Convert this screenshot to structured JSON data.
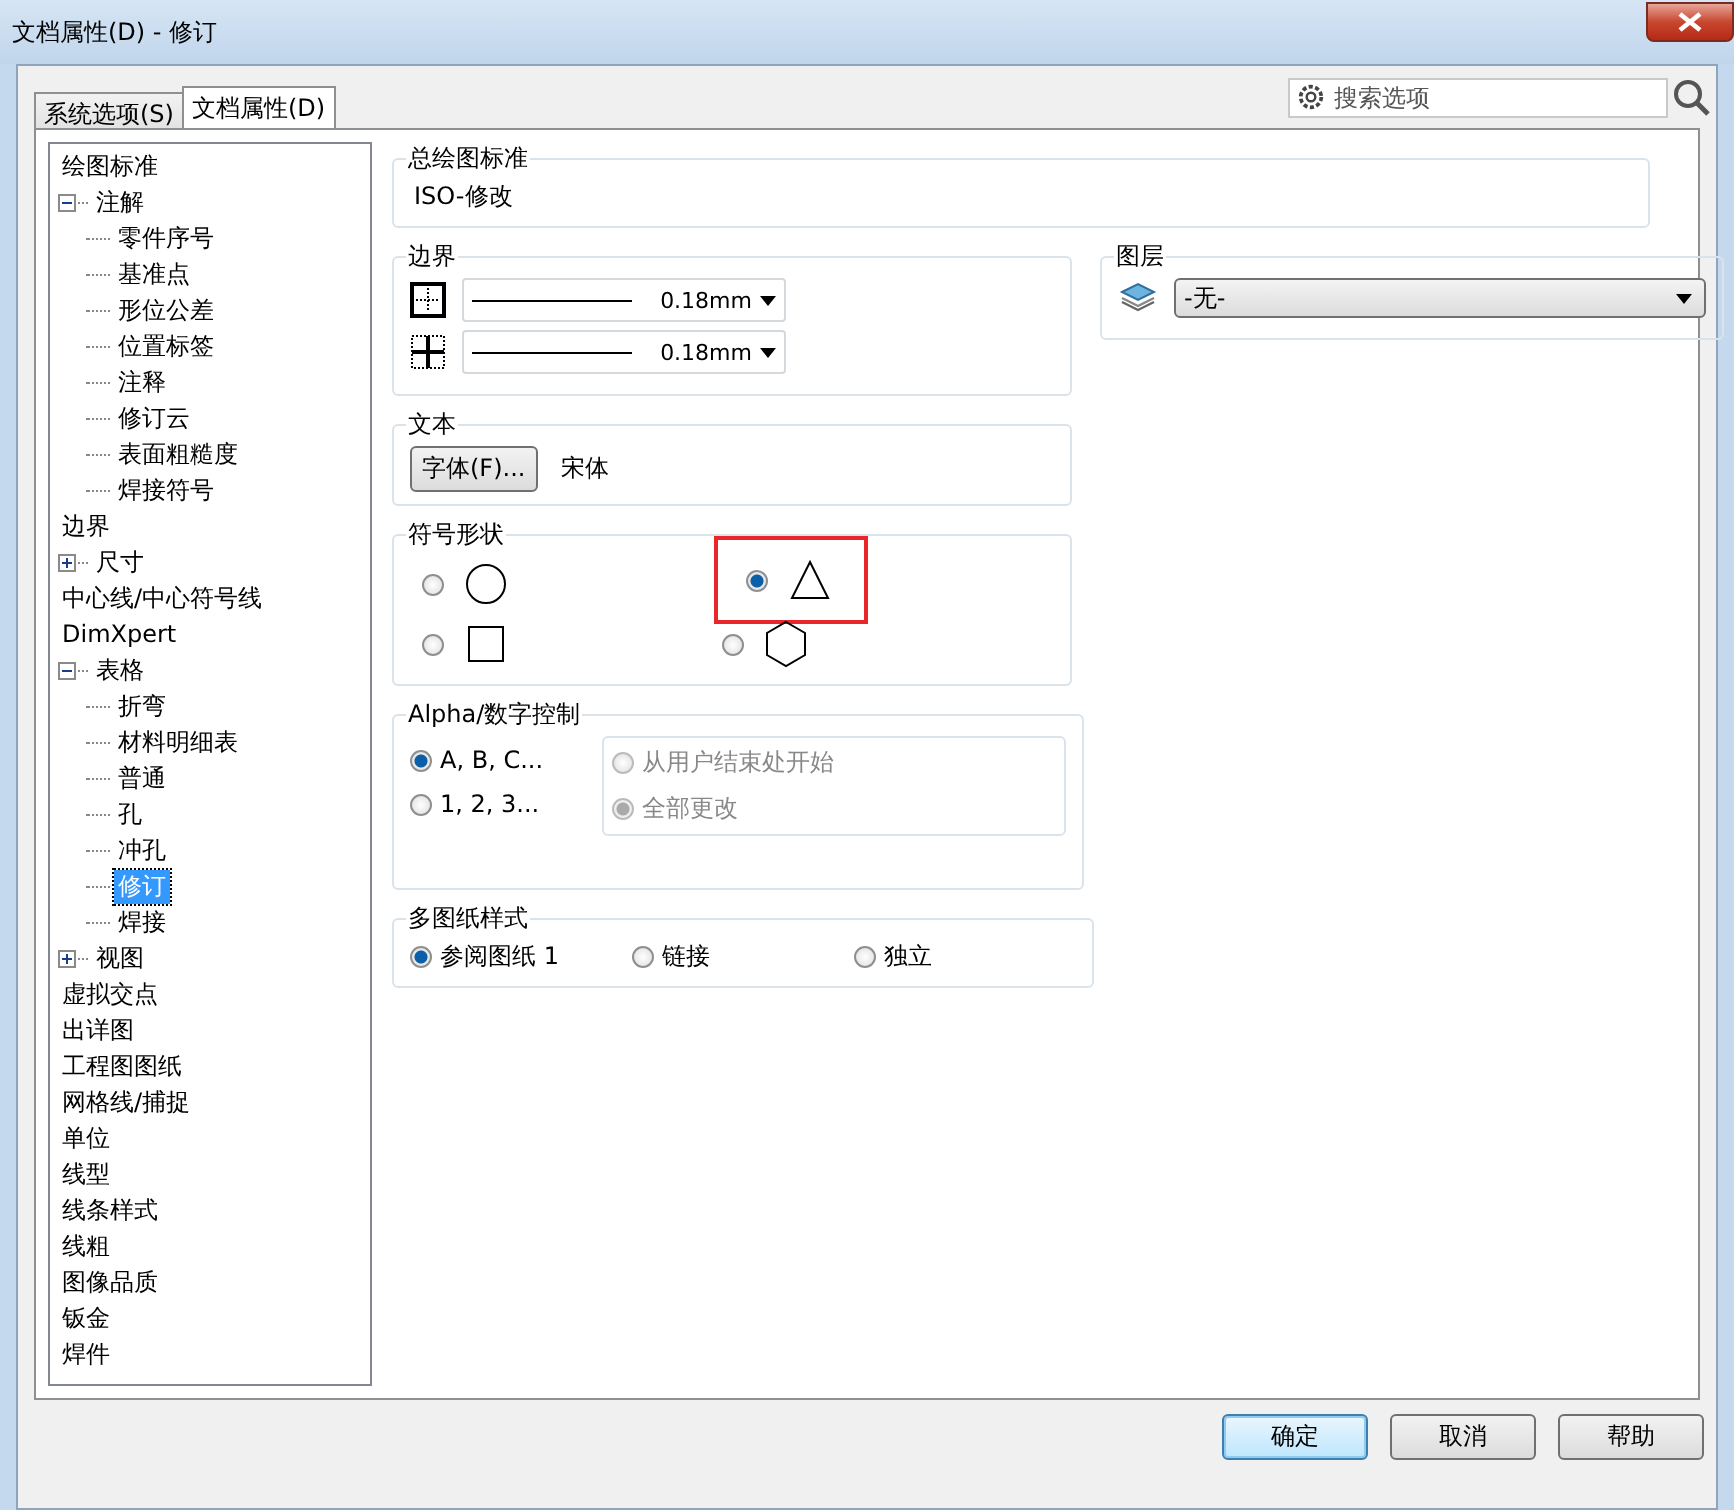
{
  "window": {
    "title": "文档属性(D) - 修订"
  },
  "tabs": [
    {
      "label": "系统选项(S)",
      "selected": false
    },
    {
      "label": "文档属性(D)",
      "selected": true
    }
  ],
  "search": {
    "placeholder": "搜索选项"
  },
  "tree": [
    {
      "label": "绘图标准",
      "selected": false
    },
    {
      "label": "注解",
      "selected": false,
      "expanded": true,
      "children": [
        {
          "label": "零件序号",
          "selected": false
        },
        {
          "label": "基准点",
          "selected": false
        },
        {
          "label": "形位公差",
          "selected": false
        },
        {
          "label": "位置标签",
          "selected": false
        },
        {
          "label": "注释",
          "selected": false
        },
        {
          "label": "修订云",
          "selected": false
        },
        {
          "label": "表面粗糙度",
          "selected": false
        },
        {
          "label": "焊接符号",
          "selected": false
        }
      ]
    },
    {
      "label": "边界",
      "selected": false
    },
    {
      "label": "尺寸",
      "selected": false,
      "expanded": false
    },
    {
      "label": "中心线/中心符号线",
      "selected": false
    },
    {
      "label": "DimXpert",
      "selected": false
    },
    {
      "label": "表格",
      "selected": false,
      "expanded": true,
      "children": [
        {
          "label": "折弯",
          "selected": false
        },
        {
          "label": "材料明细表",
          "selected": false
        },
        {
          "label": "普通",
          "selected": false
        },
        {
          "label": "孔",
          "selected": false
        },
        {
          "label": "冲孔",
          "selected": false
        },
        {
          "label": "修订",
          "selected": true
        },
        {
          "label": "焊接",
          "selected": false
        }
      ]
    },
    {
      "label": "视图",
      "selected": false,
      "expanded": false
    },
    {
      "label": "虚拟交点",
      "selected": false
    }
  ],
  "tree_roots": [
    {
      "label": "出详图",
      "selected": false
    },
    {
      "label": "工程图图纸",
      "selected": false
    },
    {
      "label": "网格线/捕捉",
      "selected": false
    },
    {
      "label": "单位",
      "selected": false
    },
    {
      "label": "线型",
      "selected": false
    },
    {
      "label": "线条样式",
      "selected": false
    },
    {
      "label": "线粗",
      "selected": false
    },
    {
      "label": "图像品质",
      "selected": false
    },
    {
      "label": "钣金",
      "selected": false
    },
    {
      "label": "焊件",
      "selected": false
    }
  ],
  "overall_standard": {
    "title": "总绘图标准",
    "value": "ISO-修改"
  },
  "border": {
    "title": "边界",
    "lines": [
      {
        "kind": "outer",
        "value": "0.18mm"
      },
      {
        "kind": "inner",
        "value": "0.18mm"
      }
    ]
  },
  "text": {
    "title": "文本",
    "button": "字体(F)...",
    "font": "宋体"
  },
  "symbol_shape": {
    "title": "符号形状",
    "options": [
      {
        "kind": "circle",
        "selected": false,
        "highlighted": false
      },
      {
        "kind": "triangle",
        "selected": true,
        "highlighted": true
      },
      {
        "kind": "square",
        "selected": false,
        "highlighted": false
      },
      {
        "kind": "hexagon",
        "selected": false,
        "highlighted": false
      }
    ]
  },
  "alpha_control": {
    "title": "Alpha/数字控制",
    "options": [
      {
        "label": "A, B, C...",
        "selected": true
      },
      {
        "label": "1, 2, 3...",
        "selected": false
      }
    ],
    "sub_options": [
      {
        "label": "从用户结束处开始",
        "selected": false,
        "disabled": true
      },
      {
        "label": "全部更改",
        "selected": true,
        "disabled": true
      }
    ]
  },
  "multi_sheet": {
    "title": "多图纸样式",
    "options": [
      {
        "label": "参阅图纸 1",
        "selected": true
      },
      {
        "label": "链接",
        "selected": false
      },
      {
        "label": "独立",
        "selected": false
      }
    ]
  },
  "layer": {
    "title": "图层",
    "value": "-无-"
  },
  "buttons": [
    {
      "label": "确定",
      "default": true
    },
    {
      "label": "取消",
      "default": false
    },
    {
      "label": "帮助",
      "default": false
    }
  ]
}
